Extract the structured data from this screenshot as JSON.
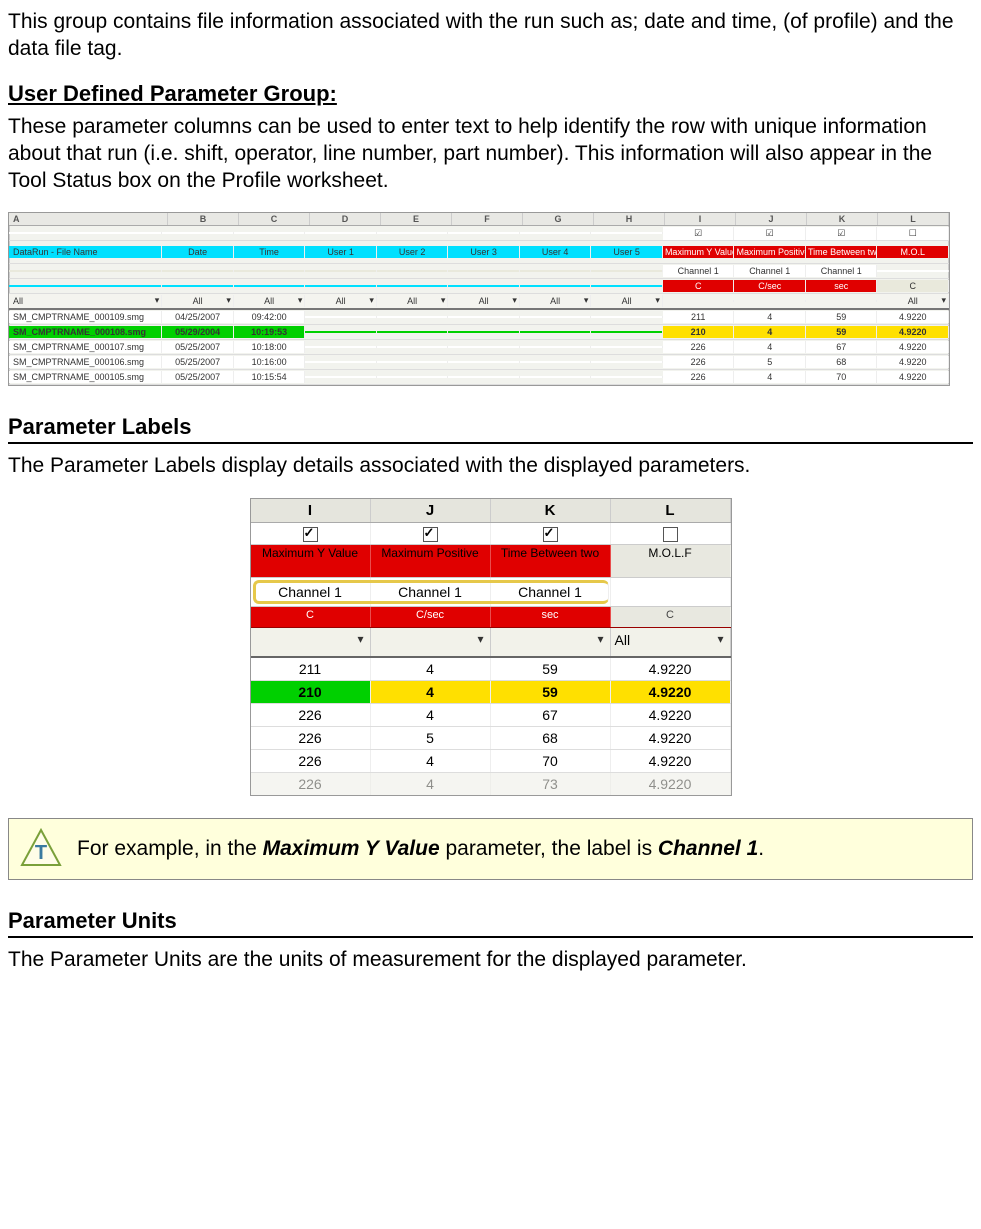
{
  "intro_para": "This group contains file information associated with the run such as; date and time, (of profile) and the data file tag.",
  "udpg_heading": "User Defined Parameter Group:",
  "udpg_para": "These parameter columns can be used to enter text to help identify the row with unique information about that run (i.e. shift, operator, line number, part number). This information will also appear in the Tool Status box on the Profile worksheet.",
  "ss1": {
    "cols": [
      "A",
      "B",
      "C",
      "D",
      "E",
      "F",
      "G",
      "H",
      "I",
      "J",
      "K",
      "L"
    ],
    "hdr_cyan": [
      "DataRun - File Name",
      "Date",
      "Time",
      "User 1",
      "User 2",
      "User 3",
      "User 4",
      "User 5"
    ],
    "hdr_red": [
      "Maximum Y Value",
      "Maximum Positive",
      "Time Between two",
      "M.O.L"
    ],
    "chan_row": [
      "Channel 1",
      "Channel 1",
      "Channel 1",
      ""
    ],
    "filter_all": "All",
    "rows": [
      {
        "fn": "SM_CMPTRNAME_000109.smg",
        "d": "04/25/2007",
        "t": "09:42:00",
        "v": [
          "211",
          "4",
          "59",
          "4.9220"
        ],
        "hl": false
      },
      {
        "fn": "SM_CMPTRNAME_000108.smg",
        "d": "05/29/2004",
        "t": "10:19:53",
        "v": [
          "210",
          "4",
          "59",
          "4.9220"
        ],
        "hl": true
      },
      {
        "fn": "SM_CMPTRNAME_000107.smg",
        "d": "05/25/2007",
        "t": "10:18:00",
        "v": [
          "226",
          "4",
          "67",
          "4.9220"
        ],
        "hl": false
      },
      {
        "fn": "SM_CMPTRNAME_000106.smg",
        "d": "05/25/2007",
        "t": "10:16:00",
        "v": [
          "226",
          "5",
          "68",
          "4.9220"
        ],
        "hl": false
      },
      {
        "fn": "SM_CMPTRNAME_000105.smg",
        "d": "05/25/2007",
        "t": "10:15:54",
        "v": [
          "226",
          "4",
          "70",
          "4.9220"
        ],
        "hl": false
      }
    ]
  },
  "pl_heading": "Parameter Labels",
  "pl_para": "The Parameter Labels display details associated with the displayed parameters.",
  "ss2": {
    "cols": [
      "I",
      "J",
      "K",
      "L"
    ],
    "checks": [
      true,
      true,
      true,
      false
    ],
    "red_hdrs": [
      "Maximum Y Value",
      "Maximum Positive",
      "Time Between two",
      "M.O.L.F"
    ],
    "channels": [
      "Channel 1",
      "Channel 1",
      "Channel 1",
      ""
    ],
    "units": [
      "C",
      "C/sec",
      "sec",
      "C"
    ],
    "filter_last": "All",
    "rows": [
      {
        "v": [
          "211",
          "4",
          "59",
          "4.9220"
        ],
        "hl": false
      },
      {
        "v": [
          "210",
          "4",
          "59",
          "4.9220"
        ],
        "hl": true
      },
      {
        "v": [
          "226",
          "4",
          "67",
          "4.9220"
        ],
        "hl": false
      },
      {
        "v": [
          "226",
          "5",
          "68",
          "4.9220"
        ],
        "hl": false
      },
      {
        "v": [
          "226",
          "4",
          "70",
          "4.9220"
        ],
        "hl": false
      },
      {
        "v": [
          "226",
          "4",
          "73",
          "4.9220"
        ],
        "hl": false
      }
    ]
  },
  "note_pre": "For example, in the ",
  "note_b1": "Maximum Y Value",
  "note_mid": " parameter, the label is ",
  "note_b2": "Channel 1",
  "note_post": ".",
  "pu_heading": "Parameter Units",
  "pu_para": "The Parameter Units are the units of measurement for the displayed parameter."
}
